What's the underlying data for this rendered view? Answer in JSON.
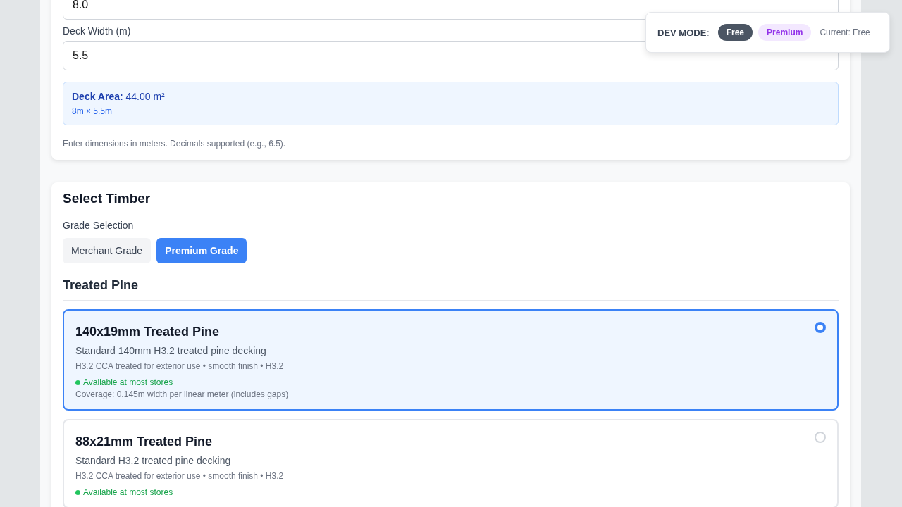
{
  "dimensions": {
    "length_field": {
      "value": "8.0"
    },
    "width_field": {
      "label": "Deck Width (m)",
      "value": "5.5"
    },
    "area": {
      "label": "Deck Area:",
      "value": "44.00 m²",
      "formula": "8m × 5.5m"
    },
    "hint": "Enter dimensions in meters. Decimals supported (e.g., 6.5)."
  },
  "timber": {
    "title": "Select Timber",
    "grade_label": "Grade Selection",
    "grades": [
      {
        "label": "Merchant Grade",
        "selected": false
      },
      {
        "label": "Premium Grade",
        "selected": true
      }
    ],
    "category": "Treated Pine",
    "options": [
      {
        "name": "140x19mm Treated Pine",
        "description": "Standard 140mm H3.2 treated pine decking",
        "details": "H3.2 CCA treated for exterior use • smooth finish • H3.2",
        "availability": "Available at most stores",
        "coverage": "Coverage: 0.145m width per linear meter (includes gaps)",
        "selected": true
      },
      {
        "name": "88x21mm Treated Pine",
        "description": "Standard H3.2 treated pine decking",
        "details": "H3.2 CCA treated for exterior use • smooth finish • H3.2",
        "availability": "Available at most stores",
        "selected": false
      }
    ]
  },
  "dev_mode": {
    "label": "DEV MODE:",
    "modes": [
      {
        "label": "Free",
        "selected": true,
        "kind": "free"
      },
      {
        "label": "Premium",
        "selected": false,
        "kind": "premium"
      }
    ],
    "current": "Current: Free"
  }
}
